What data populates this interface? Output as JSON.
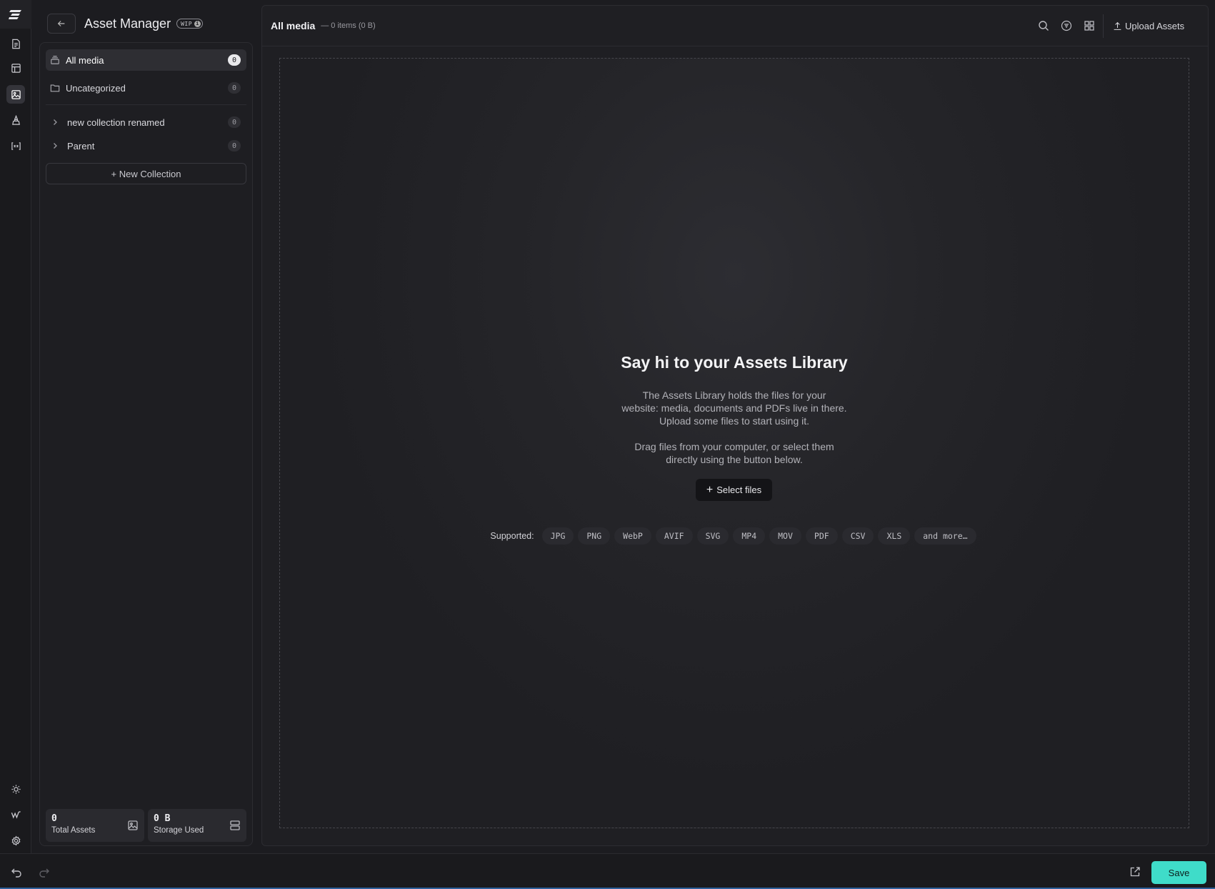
{
  "sidebar_header": {
    "title": "Asset Manager",
    "badge": "WIP",
    "badge_info": "i"
  },
  "collections": {
    "all_media": {
      "label": "All media",
      "count": "0"
    },
    "uncategorized": {
      "label": "Uncategorized",
      "count": "0"
    },
    "items": [
      {
        "label": "new collection renamed",
        "count": "0"
      },
      {
        "label": "Parent",
        "count": "0"
      }
    ],
    "new_collection_label": "+ New Collection"
  },
  "stats": {
    "total_assets": {
      "value": "0",
      "label": "Total Assets"
    },
    "storage_used": {
      "value": "0 B",
      "label": "Storage Used"
    }
  },
  "main": {
    "title": "All media",
    "subtitle": "— 0 items (0 B)",
    "upload_label": "Upload Assets"
  },
  "empty_state": {
    "title": "Say hi to your Assets Library",
    "paragraph1": [
      "The Assets Library holds the files for your",
      "website: media, documents and PDFs live in there.",
      "Upload some files to start using it."
    ],
    "paragraph2": [
      "Drag files from your computer, or select them",
      "directly using the button below."
    ],
    "select_label": "Select files",
    "supported_label": "Supported:",
    "formats": [
      "JPG",
      "PNG",
      "WebP",
      "AVIF",
      "SVG",
      "MP4",
      "MOV",
      "PDF",
      "CSV",
      "XLS",
      "and more…"
    ]
  },
  "bottom_bar": {
    "save_label": "Save"
  },
  "colors": {
    "accent": "#3fdcc9",
    "background": "#1c1c20"
  }
}
